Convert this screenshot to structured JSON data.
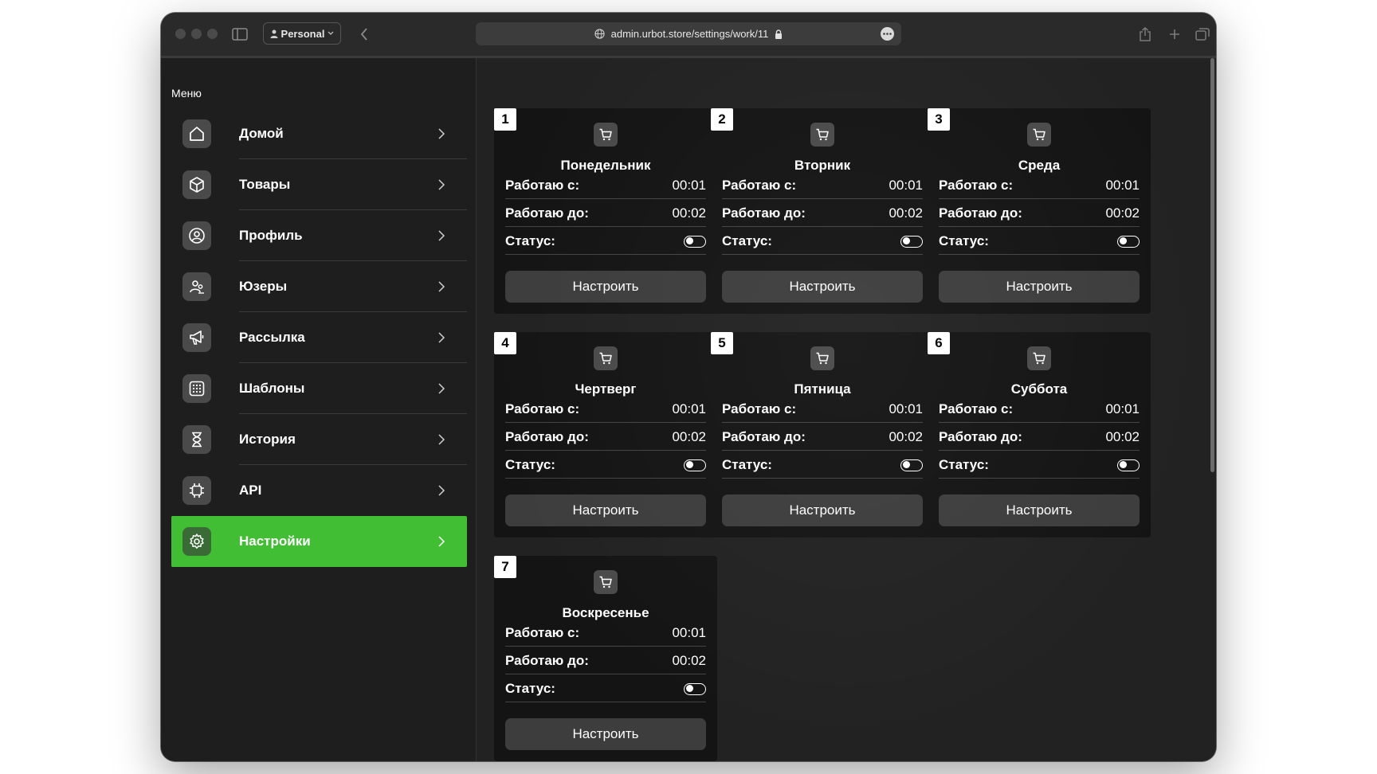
{
  "browser": {
    "profile": "Personal",
    "url": "admin.urbot.store/settings/work/11"
  },
  "sidebar": {
    "title": "Меню",
    "items": [
      {
        "label": "Домой",
        "icon": "home-icon"
      },
      {
        "label": "Товары",
        "icon": "box-icon"
      },
      {
        "label": "Профиль",
        "icon": "user-circle-icon"
      },
      {
        "label": "Юзеры",
        "icon": "users-icon"
      },
      {
        "label": "Рассылка",
        "icon": "megaphone-icon"
      },
      {
        "label": "Шаблоны",
        "icon": "grid-icon"
      },
      {
        "label": "История",
        "icon": "hourglass-icon"
      },
      {
        "label": "API",
        "icon": "chip-icon"
      },
      {
        "label": "Настройки",
        "icon": "gear-icon",
        "active": true
      }
    ]
  },
  "colors": {
    "accent": "#41be34",
    "card_bg": "#141414",
    "button_bg": "#3d3d3d"
  },
  "labels": {
    "from": "Работаю с:",
    "to": "Работаю до:",
    "status": "Статус:",
    "configure": "Настроить"
  },
  "days": [
    {
      "num": "1",
      "name": "Понедельник",
      "from": "00:01",
      "to": "00:02",
      "status": false
    },
    {
      "num": "2",
      "name": "Вторник",
      "from": "00:01",
      "to": "00:02",
      "status": false
    },
    {
      "num": "3",
      "name": "Среда",
      "from": "00:01",
      "to": "00:02",
      "status": false
    },
    {
      "num": "4",
      "name": "Чертверг",
      "from": "00:01",
      "to": "00:02",
      "status": false
    },
    {
      "num": "5",
      "name": "Пятница",
      "from": "00:01",
      "to": "00:02",
      "status": false
    },
    {
      "num": "6",
      "name": "Суббота",
      "from": "00:01",
      "to": "00:02",
      "status": false
    },
    {
      "num": "7",
      "name": "Воскресенье",
      "from": "00:01",
      "to": "00:02",
      "status": false
    }
  ]
}
